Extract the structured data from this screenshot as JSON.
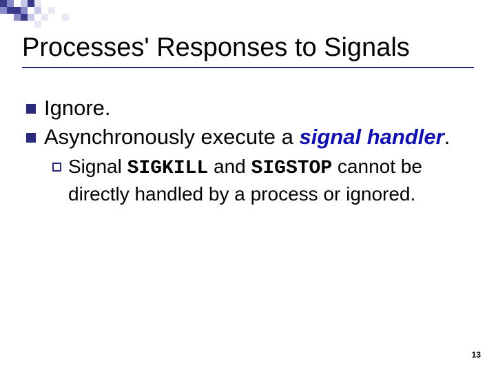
{
  "header": {
    "title": "Processes' Responses to Signals"
  },
  "bullets": {
    "b1a": "Ignore.",
    "b1b_pre": "Asynchronously execute a ",
    "b1b_em": "signal handler",
    "b1b_post": ".",
    "b2_pre": "Signal ",
    "b2_code1": "SIGKILL",
    "b2_mid": " and ",
    "b2_code2": "SIGSTOP",
    "b2_post": " cannot be directly handled by a process or ignored."
  },
  "decor": {
    "colors": {
      "dark": "#3a3a8a",
      "mid": "#8a8ac8",
      "light": "#c8c8e8",
      "pale": "#e8e8f4"
    }
  },
  "footer": {
    "page": "13"
  }
}
